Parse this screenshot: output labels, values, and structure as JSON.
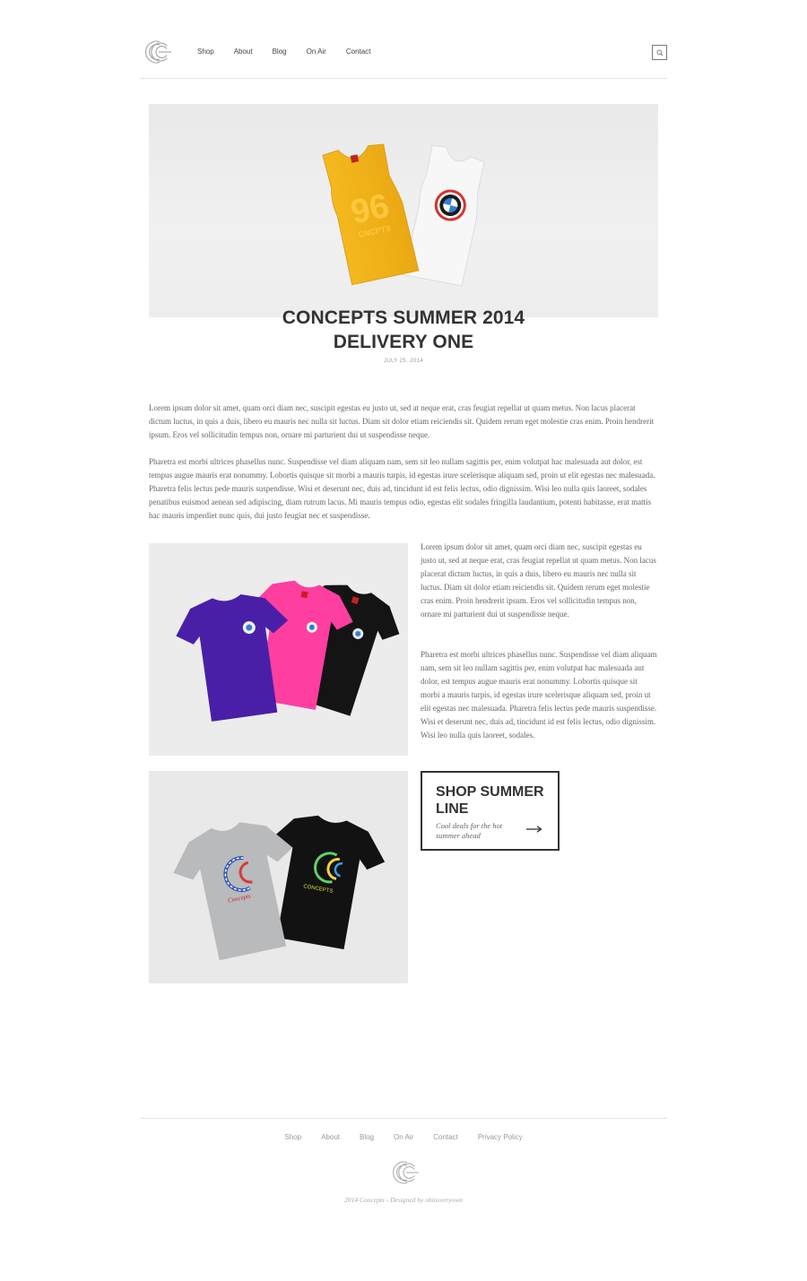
{
  "nav": {
    "items": [
      {
        "label": "Shop"
      },
      {
        "label": "About"
      },
      {
        "label": "Blog"
      },
      {
        "label": "On Air"
      },
      {
        "label": "Contact"
      }
    ],
    "search_icon": "search-icon"
  },
  "post": {
    "title_line1": "CONCEPTS SUMMER 2014",
    "title_line2": "DELIVERY ONE",
    "date": "JULY 25, 2014",
    "para1": "Lorem ipsum dolor sit amet, quam orci diam nec, suscipit egestas eu justo ut, sed at neque erat, cras feugiat repellat ut quam metus. Non lacus placerat dictum luctus, in quis a duis, libero eu mauris nec nulla sit luctus. Diam sit dolor etiam reiciendis sit. Quidem rerum eget molestie cras enim. Proin hendrerit ipsum. Eros vel sollicitudin tempus non, ornare mi parturient dui ut suspendisse neque.",
    "para2": "Pharetra est morbi ultrices phasellus nunc. Suspendisse vel diam aliquam nam, sem sit leo nullam sagittis per, enim volutpat hac malesuada aut dolor, est tempus augue mauris erat nonummy. Lobortis quisque sit morbi a mauris turpis, id egestas irure scelerisque aliquam sed, proin ut elit egestas nec malesuada. Pharetra felis lectus pede mauris suspendisse. Wisi et deserunt nec, duis ad, tincidunt id est felis lectus, odio dignissim. Wisi leo nulla quis laoreet, sodales penatibus euismod aenean sed adipiscing, diam rutrum lacus. Mi mauris tempus odio, egestas elit sodales fringilla laudantium, potenti habitasse, erat mattis hac mauris imperdiet nunc quis, dui justo feugiat nec et suspendisse.",
    "side1": "Lorem ipsum dolor sit amet, quam orci diam nec, suscipit egestas eu justo ut, sed at neque erat, cras feugiat repellat ut quam metus. Non lacus placerat dictum luctus, in quis a duis, libero eu mauris nec nulla sit luctus. Diam sit dolor etiam reiciendis sit. Quidem rerum eget molestie cras enim. Proin hendrerit ipsum. Eros vel sollicitudin tempus non, ornare mi parturient dui ut suspendisse neque.",
    "side2": "Pharetra est morbi ultrices phasellus nunc. Suspendisse vel diam aliquam nam, sem sit leo nullam sagittis per, enim volutpat hac malesuada aut dolor, est tempus augue mauris erat nonummy. Lobortis quisque sit morbi a mauris turpis, id egestas irure scelerisque aliquam sed, proin ut elit egestas nec malesuada. Pharetra felis lectus pede mauris suspendisse. Wisi et deserunt nec, duis ad, tincidunt id est felis lectus, odio dignissim. Wisi leo nulla quis laoreet, sodales."
  },
  "cta": {
    "title_line1": "SHOP SUMMER",
    "title_line2": "LINE",
    "subtitle": "Cool deals for the hot summer ahead",
    "arrow_icon": "arrow-right-icon"
  },
  "footer": {
    "items": [
      {
        "label": "Shop"
      },
      {
        "label": "About"
      },
      {
        "label": "Blog"
      },
      {
        "label": "On Air"
      },
      {
        "label": "Contact"
      },
      {
        "label": "Privacy Policy"
      }
    ],
    "credit": "2014 Concepts - Designed by ohiosveryown"
  },
  "colors": {
    "text": "#333333",
    "muted": "#999999",
    "rule": "#e4e4e4",
    "tank_yellow": "#f2b31c",
    "tee_purple": "#4a1fa8",
    "tee_pink": "#ff3fa0",
    "tee_black": "#111111",
    "tee_grey": "#b9babc"
  }
}
